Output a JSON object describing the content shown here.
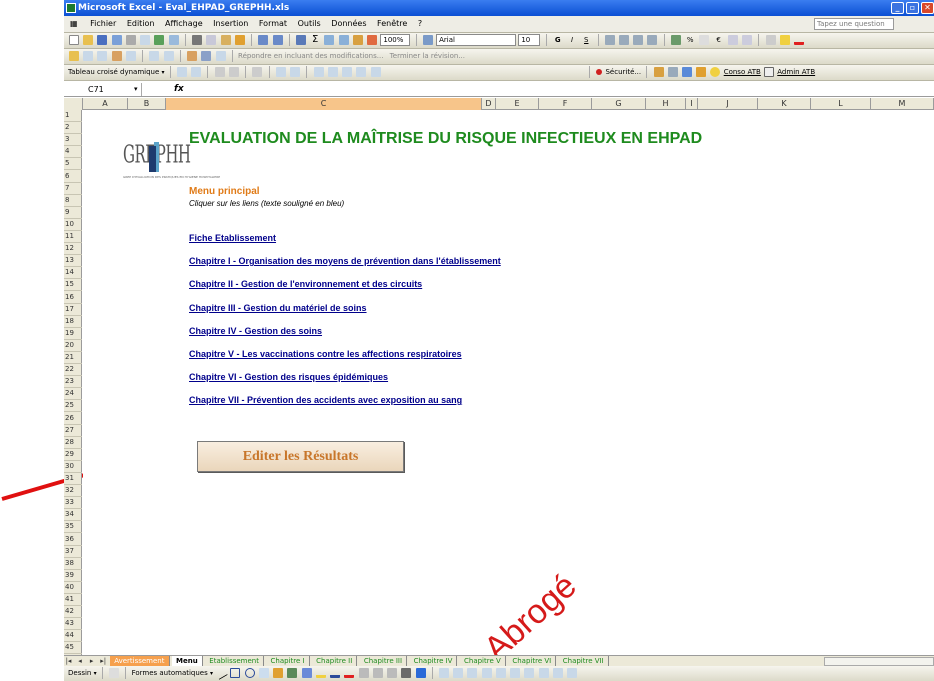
{
  "window": {
    "title": "Microsoft Excel - Eval_EHPAD_GREPHH.xls"
  },
  "menu": [
    "Fichier",
    "Edition",
    "Affichage",
    "Insertion",
    "Format",
    "Outils",
    "Données",
    "Fenêtre",
    "?"
  ],
  "question_box": "Tapez une question",
  "toolbar1": {
    "zoom": "100%",
    "font": "Arial",
    "size": "10"
  },
  "toolbar2": {
    "review_text": "Répondre en incluant des modifications...",
    "end_review": "Terminer la révision..."
  },
  "toolbar3": {
    "pivot": "Tableau croisé dynamique",
    "securite": "Sécurité...",
    "conso": "Conso ATB",
    "admin": "Admin ATB"
  },
  "name_box": "C71",
  "fx": "fx",
  "columns": [
    "A",
    "B",
    "C",
    "D",
    "E",
    "F",
    "G",
    "H",
    "I",
    "J",
    "K",
    "L",
    "M"
  ],
  "rows": [
    "1",
    "2",
    "3",
    "4",
    "5",
    "6",
    "7",
    "8",
    "9",
    "10",
    "11",
    "12",
    "13",
    "14",
    "15",
    "16",
    "17",
    "18",
    "19",
    "20",
    "21",
    "22",
    "23",
    "24",
    "25",
    "26",
    "27",
    "28",
    "29",
    "30",
    "31",
    "32",
    "33",
    "34",
    "35",
    "36",
    "37",
    "38",
    "39",
    "40",
    "41",
    "42",
    "43",
    "44",
    "45"
  ],
  "logo_text": "GREPHH",
  "logo_subtext": "GREP D'EVALUATION DES PRATIQUES EN HYGIENE HOSPITALIERE",
  "heading": "EVALUATION DE LA MAÎTRISE DU RISQUE INFECTIEUX EN EHPAD",
  "menu_title": "Menu principal",
  "hint": "Cliquer sur les liens (texte souligné en bleu)",
  "links": [
    "Fiche Etablissement",
    "Chapitre I - Organisation des moyens de prévention dans l'établissement",
    "Chapitre II - Gestion de l'environnement et des circuits",
    "Chapitre III - Gestion du matériel de soins",
    "Chapitre IV - Gestion des soins",
    "Chapitre V - Les vaccinations contre les affections respiratoires",
    "Chapitre VI - Gestion des risques épidémiques",
    "Chapitre VII - Prévention des accidents avec exposition au sang"
  ],
  "button_label": "Editer les Résultats",
  "watermark": "Abrogé",
  "sheet_tabs": [
    "Avertissement",
    "Menu",
    "Etablissement",
    "Chapitre I",
    "Chapitre II",
    "Chapitre III",
    "Chapitre IV",
    "Chapitre V",
    "Chapitre VI",
    "Chapitre VII"
  ],
  "drawbar": {
    "dessin": "Dessin",
    "formes": "Formes automatiques"
  },
  "colors": {
    "heading": "#1e8b1e",
    "menu_title": "#e07b18",
    "link": "#00008b",
    "arrow": "#e01010"
  }
}
